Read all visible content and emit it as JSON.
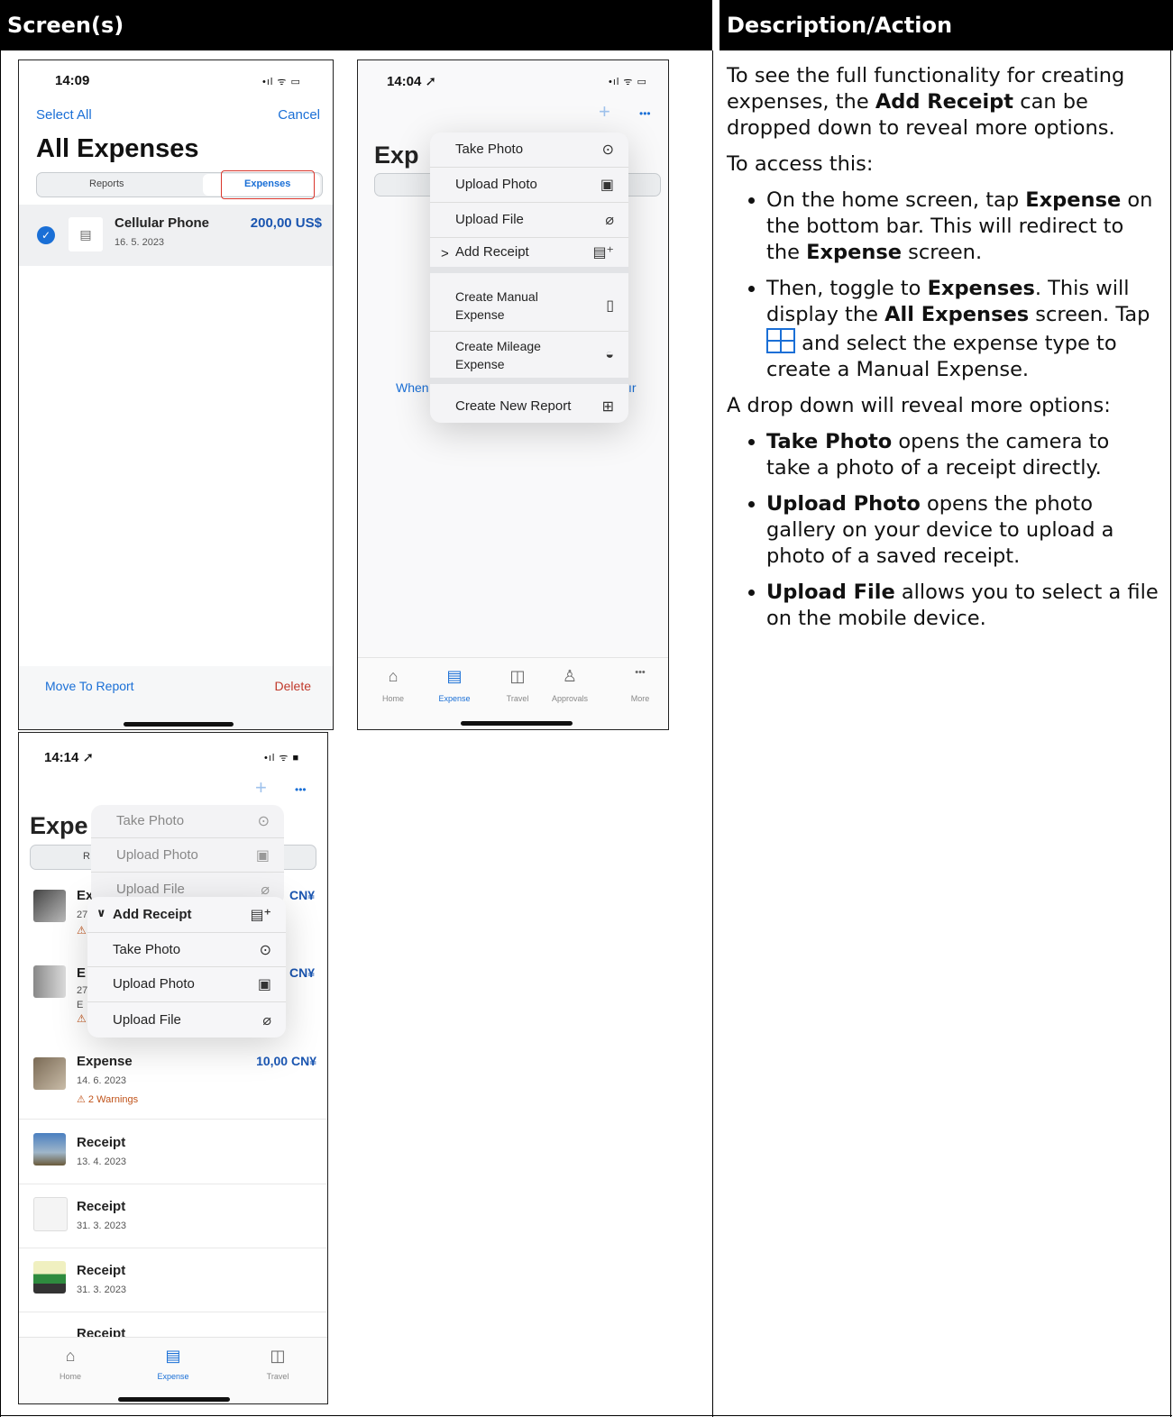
{
  "header": {
    "col1": "Screen(s)",
    "col2": "Description/Action"
  },
  "phone1": {
    "time": "14:09",
    "signal": "•ıl ᯤ ▭",
    "select_all": "Select All",
    "cancel": "Cancel",
    "title": "All Expenses",
    "seg_reports": "Reports",
    "seg_expenses": "Expenses",
    "item_title": "Cellular Phone",
    "item_date": "16. 5. 2023",
    "item_amount": "200,00 US$",
    "move_to_report": "Move To Report",
    "delete": "Delete"
  },
  "phone2": {
    "time": "14:04 ➚",
    "signal": "•ıl ᯤ ▭",
    "plus": "+",
    "dots": "•••",
    "title_partial": "Exp",
    "when_left": "When",
    "when_right": "ır",
    "menu": [
      {
        "label": "Take Photo",
        "icon": "camera-icon",
        "glyph": "⊙"
      },
      {
        "label": "Upload Photo",
        "icon": "image-icon",
        "glyph": "▣"
      },
      {
        "label": "Upload File",
        "icon": "paperclip-icon",
        "glyph": "⌀"
      },
      {
        "label": "Add Receipt",
        "prefix": ">",
        "icon": "receipt-add-icon",
        "glyph": "▤⁺"
      },
      {
        "label": "Create Manual Expense",
        "icon": "document-icon",
        "glyph": "▯"
      },
      {
        "label": "Create Mileage Expense",
        "icon": "gauge-icon",
        "glyph": "◒"
      },
      {
        "label": "Create New Report",
        "icon": "report-icon",
        "glyph": "⊞"
      }
    ],
    "tabs": [
      "Home",
      "Expense",
      "Travel",
      "Approvals",
      "More"
    ]
  },
  "phone3": {
    "time": "14:14 ➚",
    "signal": "•ıl ᯤ ■",
    "plus": "+",
    "dots": "•••",
    "title_partial": "Expe",
    "seg_partial": "R",
    "faded_menu": [
      "Take Photo",
      "Upload Photo",
      "Upload File"
    ],
    "sub_header": "Add Receipt",
    "sub_menu": [
      "Take Photo",
      "Upload Photo",
      "Upload File"
    ],
    "partial_rows": [
      {
        "t": "Ex",
        "d": "27",
        "amount": "CN¥"
      },
      {
        "t": "E",
        "d": "27",
        "d2": "E",
        "amount": "CN¥"
      }
    ],
    "rows": [
      {
        "title": "Expense",
        "date": "14. 6. 2023",
        "warning": "2 Warnings",
        "amount": "10,00 CN¥"
      },
      {
        "title": "Receipt",
        "date": "13. 4. 2023"
      },
      {
        "title": "Receipt",
        "date": "31. 3. 2023"
      },
      {
        "title": "Receipt",
        "date": "31. 3. 2023"
      },
      {
        "title": "Receipt"
      }
    ],
    "tabs": [
      "Home",
      "Expense",
      "Travel"
    ]
  },
  "description": {
    "p1_a": "To see the full functionality for creating expenses, the ",
    "p1_b": "Add Receipt",
    "p1_c": " can be dropped down to reveal more options.",
    "p2": "To access this:",
    "b1_a": "On the home screen, tap ",
    "b1_b": "Expense",
    "b1_c": " on the bottom bar. This will redirect to the ",
    "b1_d": "Expense",
    "b1_e": " screen.",
    "b2_a": "Then, toggle to ",
    "b2_b": "Expenses",
    "b2_c": ". This will display the ",
    "b2_d": "All Expenses",
    "b2_e": " screen. Tap ",
    "b2_f": " and select the expense type to create a Manual Expense.",
    "p3": "A drop down will reveal more options:",
    "b3_a": "Take Photo",
    "b3_b": " opens the camera to take a photo of a receipt directly.",
    "b4_a": "Upload Photo",
    "b4_b": " opens the photo gallery on your device to upload a photo of a saved receipt.",
    "b5_a": "Upload File",
    "b5_b": " allows you to select a file on the mobile device."
  },
  "colors": {
    "accent": "#1a6fd6",
    "delete": "#c0392b",
    "warning": "#c0531a"
  }
}
